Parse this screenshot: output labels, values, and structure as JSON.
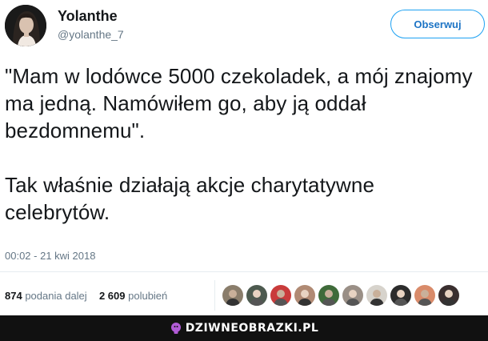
{
  "author": {
    "name": "Yolanthe",
    "handle": "@yolanthe_7",
    "avatar_icon": "profile-photo"
  },
  "follow_button": {
    "label": "Obserwuj"
  },
  "tweet": {
    "paragraph_1": "\"Mam w lodówce 5000 czekoladek, a mój znajomy ma jedną. Namówiłem go, aby ją oddał bezdomnemu\".",
    "paragraph_2": "Tak właśnie działają akcje charytatywne celebrytów.",
    "timestamp": "00:02 - 21 kwi 2018"
  },
  "stats": {
    "retweets_count": "874",
    "retweets_label": "podania dalej",
    "likes_count": "2 609",
    "likes_label": "polubień"
  },
  "likers": [
    {
      "icon": "liker-avatar-1",
      "color": "#8a7d6b"
    },
    {
      "icon": "liker-avatar-2",
      "color": "#4d5a4f"
    },
    {
      "icon": "liker-avatar-3",
      "color": "#c93b3b"
    },
    {
      "icon": "liker-avatar-4",
      "color": "#b08a74"
    },
    {
      "icon": "liker-avatar-5",
      "color": "#3f6b3a"
    },
    {
      "icon": "liker-avatar-6",
      "color": "#9a8f86"
    },
    {
      "icon": "liker-avatar-7",
      "color": "#d7d3cc"
    },
    {
      "icon": "liker-avatar-8",
      "color": "#2c2c2c"
    },
    {
      "icon": "liker-avatar-9",
      "color": "#d98b6a"
    },
    {
      "icon": "liker-avatar-10",
      "color": "#3a2f2f"
    }
  ],
  "watermark": {
    "text": "DZIWNEOBRAZKI.PL",
    "icon": "bulb-icon",
    "icon_color": "#b15bd6"
  },
  "colors": {
    "link_blue": "#1da1f2",
    "secondary_text": "#657786",
    "footer_bg": "#111111"
  }
}
